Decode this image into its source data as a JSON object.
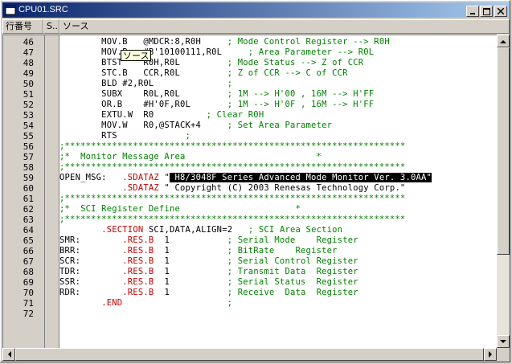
{
  "window": {
    "title": "CPU01.SRC"
  },
  "header": {
    "col_line": "行番号",
    "col_s": "S..",
    "col_source": "ソース"
  },
  "tooltip": {
    "text": "ソース"
  },
  "lines": [
    {
      "n": "46",
      "code": "        MOV.B   @MDCR:8,R0H     ; Mode Control Register --> R0H",
      "style": "plain"
    },
    {
      "n": "47",
      "code": "        MOV.B   #B'10100111,R0L     ; Area Parameter --> R0L",
      "style": "plain"
    },
    {
      "n": "48",
      "code": "        BTST    R0H,R0L         ; Mode Status --> Z of CCR",
      "style": "plain"
    },
    {
      "n": "49",
      "code": "        STC.B   CCR,R0L         ; Z of CCR --> C of CCR",
      "style": "plain"
    },
    {
      "n": "50",
      "code": "        BLD #2,R0L              ;",
      "style": "plain"
    },
    {
      "n": "51",
      "code": "        SUBX    R0L,R0L         ; 1M --> H'00 , 16M --> H'FF",
      "style": "plain"
    },
    {
      "n": "52",
      "code": "        OR.B    #H'0F,R0L       ; 1M --> H'0F , 16M --> H'FF",
      "style": "plain"
    },
    {
      "n": "53",
      "code": "        EXTU.W  R0          ; Clear R0H",
      "style": "plain"
    },
    {
      "n": "54",
      "code": "        MOV.W   R0,@STACK+4     ; Set Area Parameter",
      "style": "plain"
    },
    {
      "n": "55",
      "code": "        RTS             ;",
      "style": "plain"
    },
    {
      "n": "56",
      "code": ";*****************************************************************",
      "style": "comment"
    },
    {
      "n": "57",
      "code": ";*  Monitor Message Area                         *",
      "style": "comment"
    },
    {
      "n": "58",
      "code": ";*****************************************************************",
      "style": "comment"
    },
    {
      "n": "59",
      "code": "OPEN_MSG:   .SDATAZ \" H8/3048F Series Advanced Mode Monitor Ver. 3.0AA\"",
      "style": "sdataz_sel"
    },
    {
      "n": "60",
      "code": "            .SDATAZ \" Copyright (C) 2003 Renesas Technology Corp.\"",
      "style": "sdataz"
    },
    {
      "n": "61",
      "code": ";*****************************************************************",
      "style": "comment"
    },
    {
      "n": "62",
      "code": ";*  SCI Register Define                      *",
      "style": "comment"
    },
    {
      "n": "63",
      "code": ";*****************************************************************",
      "style": "comment"
    },
    {
      "n": "64",
      "code": "        .SECTION SCI,DATA,ALIGN=2   ; SCI Area Section",
      "style": "section"
    },
    {
      "n": "65",
      "code": "SMR:        .RES.B  1           ; Serial Mode    Register",
      "style": "res"
    },
    {
      "n": "66",
      "code": "BRR:        .RES.B  1           ; BitRate    Register",
      "style": "res"
    },
    {
      "n": "67",
      "code": "SCR:        .RES.B  1           ; Serial Control Register",
      "style": "res"
    },
    {
      "n": "68",
      "code": "TDR:        .RES.B  1           ; Transmit Data  Register",
      "style": "res"
    },
    {
      "n": "69",
      "code": "SSR:        .RES.B  1           ; Serial Status  Register",
      "style": "res"
    },
    {
      "n": "70",
      "code": "RDR:        .RES.B  1           ; Receive  Data  Register",
      "style": "res"
    },
    {
      "n": "71",
      "code": "        .END                    ;",
      "style": "end"
    },
    {
      "n": "72",
      "code": "",
      "style": "plain"
    }
  ],
  "colors": {
    "comment": "#008000",
    "directive": "#c00000",
    "keyword": "#0000c0",
    "title_start": "#0a246a",
    "title_end": "#a6caf0"
  }
}
